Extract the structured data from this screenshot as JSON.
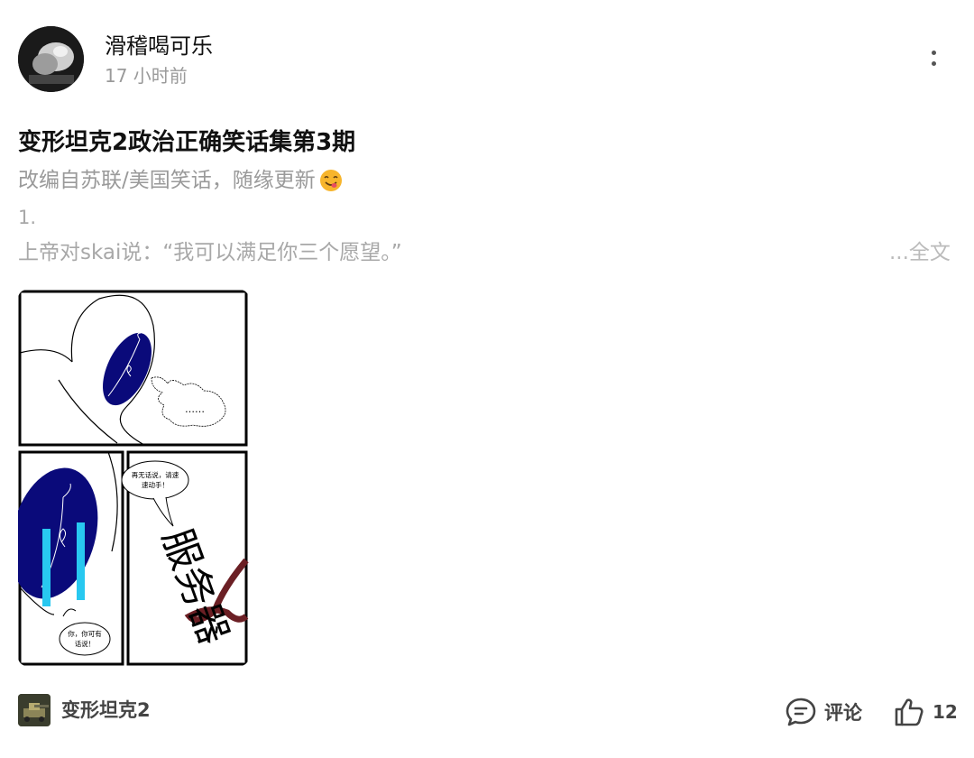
{
  "author": {
    "name": "滑稽喝可乐",
    "time": "17 小时前",
    "avatar_icon": "avatar-photo"
  },
  "header": {
    "more_icon": "vertical-ellipsis-icon"
  },
  "post": {
    "title": "变形坦克2政治正确笑话集第3期",
    "subtitle": "改编自苏联/美国笑话，随缘更新",
    "subtitle_emoji": "yum-face-emoji",
    "line_1": "1.",
    "line_2": "上帝对skai说：“我可以满足你三个愿望。”",
    "full_text_link": "...全文"
  },
  "comic": {
    "panel_1_bubble": "……",
    "panel_2_bubble_line1": "你，你可有",
    "panel_2_bubble_line2": "话说！",
    "panel_3_bubble_line1": "再无话说，请速",
    "panel_3_bubble_line2": "速动手！",
    "panel_3_big_text": "服务器",
    "colors": {
      "navy": "#0a0a7a",
      "cyan": "#28c8f0",
      "maroon": "#6b1f24"
    }
  },
  "footer": {
    "topic_name": "变形坦克2",
    "comment_label": "评论",
    "comment_icon": "comment-bubble-icon",
    "like_icon": "thumbs-up-icon",
    "like_count": "12"
  }
}
